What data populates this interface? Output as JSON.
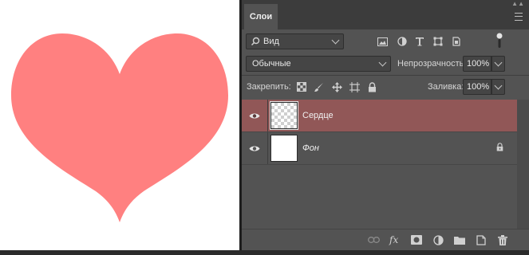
{
  "canvas": {
    "background_color": "#ffffff",
    "shape": {
      "name": "heart",
      "fill_color": "#ff8080"
    }
  },
  "panel": {
    "tab_label": "Слои",
    "collapse_glyph": "▲▲",
    "filter": {
      "value": "Вид"
    },
    "blend_mode": {
      "value": "Обычные"
    },
    "opacity": {
      "label": "Непрозрачность:",
      "value": "100%"
    },
    "lock": {
      "label": "Закрепить:"
    },
    "fill": {
      "label": "Заливка:",
      "value": "100%"
    },
    "layers": [
      {
        "name": "Сердце",
        "selected": true,
        "thumbnail": "transparent-checker",
        "visible": true
      },
      {
        "name": "Фон",
        "selected": false,
        "thumbnail": "white",
        "visible": true,
        "locked": true
      }
    ],
    "bottom_icons": [
      "link-icon",
      "fx-icon",
      "mask-icon",
      "adjustment-icon",
      "folder-icon",
      "new-layer-icon",
      "trash-icon"
    ],
    "colors": {
      "selected_row": "#915757",
      "panel_bg": "#535353",
      "tabbar_bg": "#3c3c3c"
    }
  }
}
